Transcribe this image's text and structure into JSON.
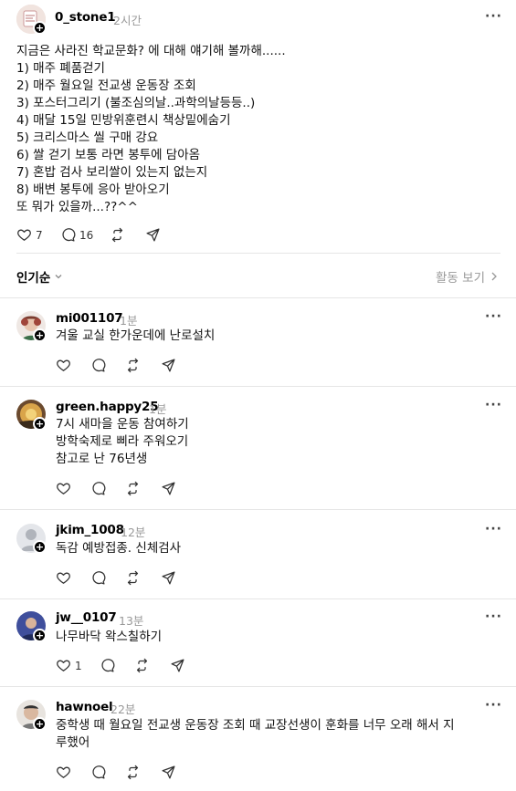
{
  "post": {
    "username": "0_stone1",
    "time": "2시간",
    "lines": [
      "지금은 사라진 학교문화? 에 대해 얘기해 볼까해......",
      "1) 매주 폐품걷기",
      "2) 매주 월요일 전교생 운동장 조회",
      "3) 포스터그리기 (불조심의날..과학의날등등..)",
      "4) 매달 15일 민방위훈련시 책상밑에숨기",
      "5) 크리스마스 씰 구매 강요",
      "6) 쌀 걷기 보통 라면 봉투에 담아옴",
      "7) 혼밥 검사 보리쌀이 있는지 없는지",
      "8) 배변 봉투에 응아 받아오기",
      "또 뭐가 있을까...??^^"
    ],
    "likes": "7",
    "comments": "16"
  },
  "sort": {
    "label": "인기순",
    "activity_label": "활동 보기"
  },
  "replies": [
    {
      "username": "mi001107",
      "time": "1분",
      "text": "겨울 교실 한가운데에 난로설치",
      "likes": ""
    },
    {
      "username": "green.happy25",
      "time": "1분",
      "text": "7시 새마을 운동 참여하기\n방학숙제로 삐라 주워오기\n참고로 난 76년생",
      "likes": ""
    },
    {
      "username": "jkim_1008",
      "time": "12분",
      "text": "독감 예방접종. 신체검사",
      "likes": ""
    },
    {
      "username": "jw__0107",
      "time": "13분",
      "text": "나무바닥 왁스칠하기",
      "likes": "1"
    },
    {
      "username": "hawnoel",
      "time": "22분",
      "text": "중학생 때 월요일 전교생 운동장 조회 때 교장선생이 훈화를 너무 오래 해서 지\n루했어",
      "likes": ""
    }
  ],
  "icons": [
    "heart-icon",
    "comment-icon",
    "repost-icon",
    "share-icon",
    "more-icon",
    "chevron-down-icon",
    "chevron-right-icon",
    "plus-icon"
  ]
}
